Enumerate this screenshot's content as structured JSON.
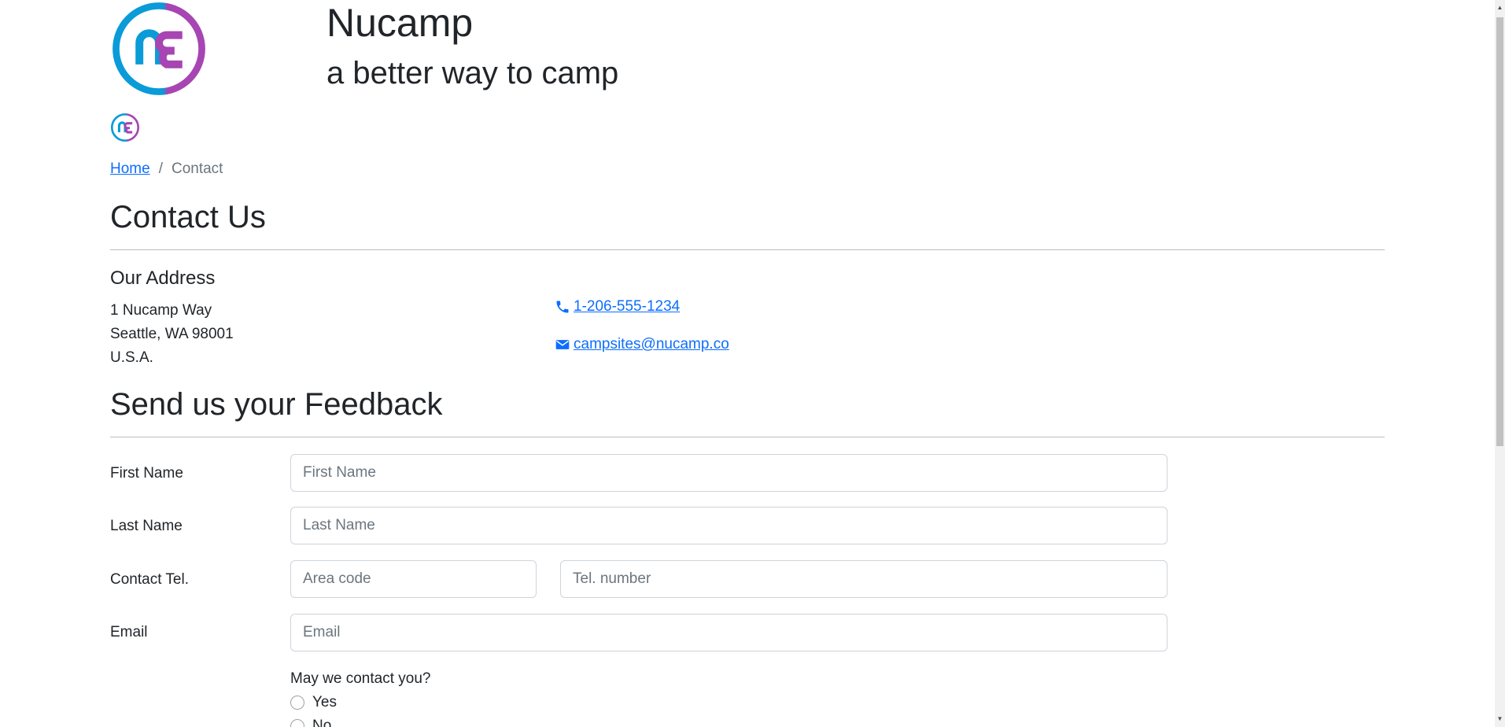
{
  "header": {
    "brand_title": "Nucamp",
    "tagline": "a better way to camp",
    "logo_icon": "nucamp-logo-icon",
    "colors": {
      "logo_blue": "#0a9bd8",
      "logo_purple": "#a745b3"
    }
  },
  "breadcrumb": {
    "home": "Home",
    "separator": "/",
    "current": "Contact"
  },
  "contact": {
    "heading": "Contact Us",
    "address_title": "Our Address",
    "address_lines": [
      "1 Nucamp Way",
      "Seattle, WA 98001",
      "U.S.A."
    ],
    "phone": " 1-206-555-1234",
    "email": " campsites@nucamp.co",
    "phone_icon": "phone-icon",
    "email_icon": "envelope-icon"
  },
  "feedback": {
    "heading": "Send us your Feedback",
    "first_name": {
      "label": "First Name",
      "placeholder": "First Name"
    },
    "last_name": {
      "label": "Last Name",
      "placeholder": "Last Name"
    },
    "tel": {
      "label": "Contact Tel.",
      "area_placeholder": "Area code",
      "number_placeholder": "Tel. number"
    },
    "email": {
      "label": "Email",
      "placeholder": "Email"
    },
    "question": "May we contact you?",
    "options": [
      "Yes",
      "No"
    ]
  },
  "theme": {
    "link_color": "#0d6efd",
    "text_color": "#212529",
    "muted_color": "#6c757d"
  }
}
